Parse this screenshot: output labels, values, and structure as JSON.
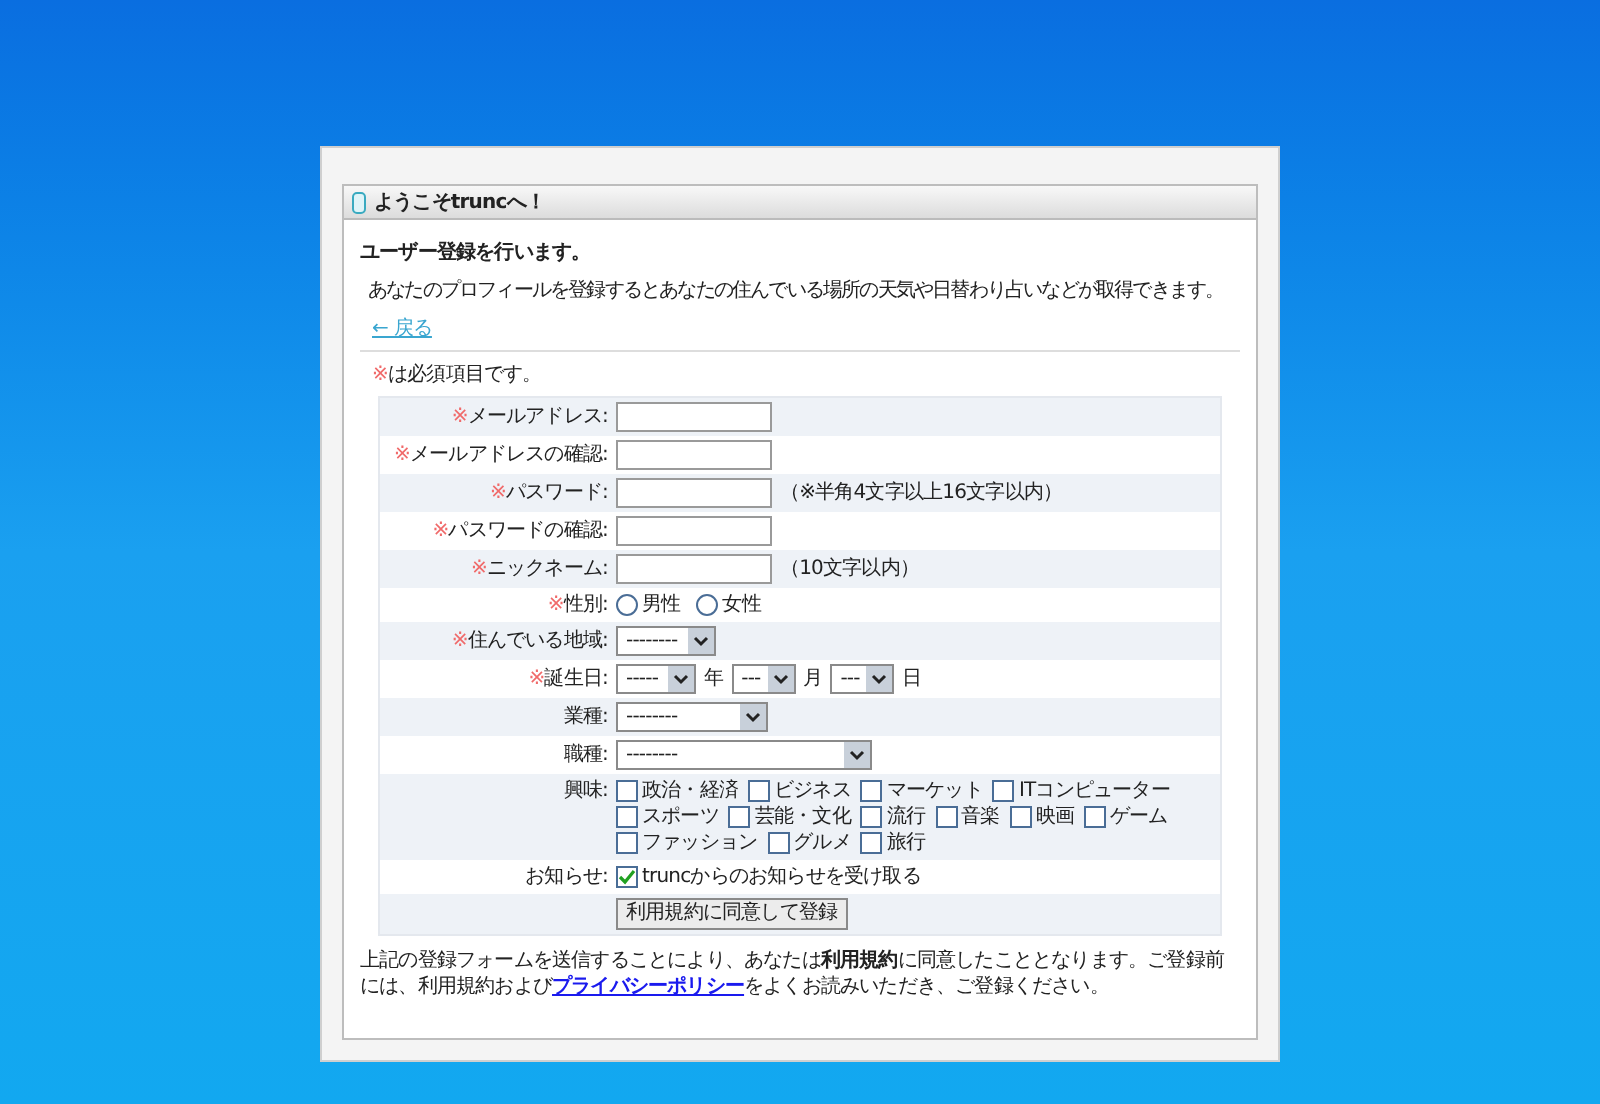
{
  "panel": {
    "title": "ようこそtruncへ！"
  },
  "heading": "ユーザー登録を行います。",
  "intro": "あなたのプロフィールを登録するとあなたの住んでいる場所の天気や日替わり占いなどが取得できます。",
  "back_link": "← 戻る",
  "required_note": {
    "mark": "※",
    "text": "は必須項目です。"
  },
  "rows": [
    {
      "kind": "text",
      "mark": "※",
      "label": "メールアドレス:",
      "value": ""
    },
    {
      "kind": "text",
      "mark": "※",
      "label": "メールアドレスの確認:",
      "value": ""
    },
    {
      "kind": "text",
      "mark": "※",
      "label": "パスワード:",
      "value": "",
      "note": "（※半角4文字以上16文字以内）"
    },
    {
      "kind": "text",
      "mark": "※",
      "label": "パスワードの確認:",
      "value": ""
    },
    {
      "kind": "text",
      "mark": "※",
      "label": "ニックネーム:",
      "value": "",
      "note": "（10文字以内）"
    },
    {
      "kind": "radio",
      "mark": "※",
      "label": "性別:",
      "options": [
        {
          "label": "男性",
          "selected": false
        },
        {
          "label": "女性",
          "selected": false
        }
      ]
    },
    {
      "kind": "select",
      "mark": "※",
      "label": "住んでいる地域:",
      "value": "--------"
    },
    {
      "kind": "date",
      "mark": "※",
      "label": "誕生日:",
      "parts": [
        {
          "value": "-----",
          "unit": "年"
        },
        {
          "value": "---",
          "unit": "月"
        },
        {
          "value": "---",
          "unit": "日"
        }
      ]
    },
    {
      "kind": "select",
      "label": "業種:",
      "value": "--------"
    },
    {
      "kind": "select",
      "label": "職種:",
      "value": "--------"
    },
    {
      "kind": "checkboxes",
      "label": "興味:",
      "options": [
        {
          "label": "政治・経済",
          "checked": false
        },
        {
          "label": "ビジネス",
          "checked": false
        },
        {
          "label": "マーケット",
          "checked": false
        },
        {
          "label": "ITコンピューター",
          "checked": false
        },
        {
          "label": "スポーツ",
          "checked": false
        },
        {
          "label": "芸能・文化",
          "checked": false
        },
        {
          "label": "流行",
          "checked": false
        },
        {
          "label": "音楽",
          "checked": false
        },
        {
          "label": "映画",
          "checked": false
        },
        {
          "label": "ゲーム",
          "checked": false
        },
        {
          "label": "ファッション",
          "checked": false
        },
        {
          "label": "グルメ",
          "checked": false
        },
        {
          "label": "旅行",
          "checked": false
        }
      ]
    },
    {
      "kind": "checkbox",
      "label": "お知らせ:",
      "option": {
        "label": "truncからのお知らせを受け取る",
        "checked": true
      }
    },
    {
      "kind": "button",
      "button": "利用規約に同意して登録"
    }
  ],
  "footer": "上記の登録フォームを送信することにより、あなたは**利用規約**に同意したこととなります。ご登録前には、利用規約および",
  "footer_link": "プライバシーポリシー",
  "footer_end": "をよくお読みいただき、ご登録ください。"
}
